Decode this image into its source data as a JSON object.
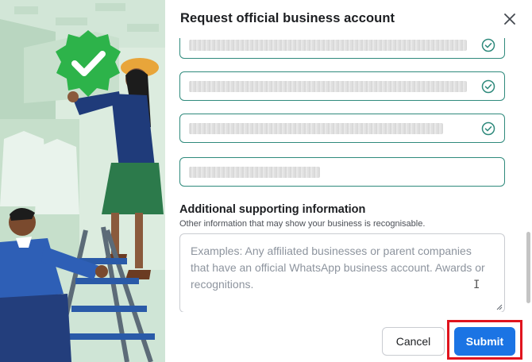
{
  "dialog": {
    "title": "Request official business account",
    "close_icon": "close-icon"
  },
  "fields": [
    {
      "value_hidden": true,
      "status_icon": "check-circle-icon"
    },
    {
      "value_hidden": true,
      "status_icon": "check-circle-icon"
    },
    {
      "value_hidden": true,
      "status_icon": "check-circle-icon"
    },
    {
      "value_hidden": true,
      "status_icon": null
    }
  ],
  "additional": {
    "heading": "Additional supporting information",
    "subtext": "Other information that may show your business is recognisable.",
    "placeholder": "Examples: Any affiliated businesses or parent companies that have an official WhatsApp business account. Awards or recognitions."
  },
  "footer": {
    "cancel_label": "Cancel",
    "submit_label": "Submit"
  },
  "colors": {
    "accent_teal": "#2f8a7c",
    "submit_blue": "#1b74e4",
    "highlight_red": "#e0141e",
    "illustration_green": "#cfe5d6"
  }
}
